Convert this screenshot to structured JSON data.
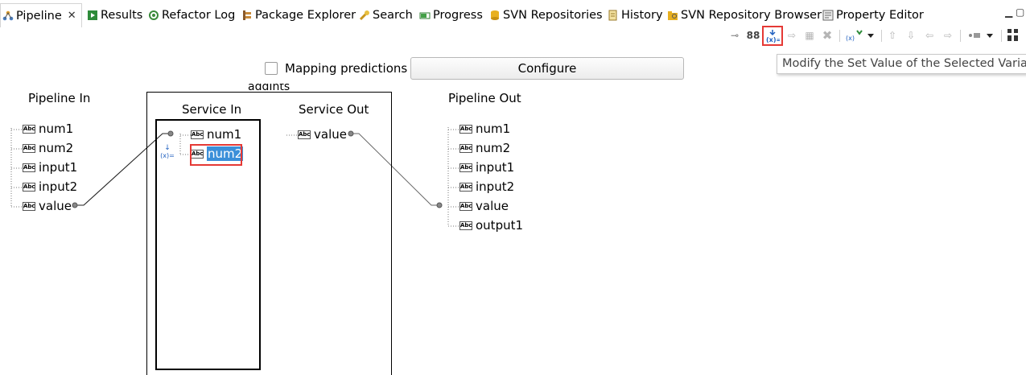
{
  "tabs": [
    {
      "label": "Pipeline",
      "icon": "pipeline-icon",
      "active": true,
      "close": "✕"
    },
    {
      "label": "Results",
      "icon": "results-icon"
    },
    {
      "label": "Refactor Log",
      "icon": "refactor-log-icon"
    },
    {
      "label": "Package Explorer",
      "icon": "package-explorer-icon"
    },
    {
      "label": "Search",
      "icon": "search-icon"
    },
    {
      "label": "Progress",
      "icon": "progress-icon"
    },
    {
      "label": "SVN Repositories",
      "icon": "svn-repositories-icon"
    },
    {
      "label": "History",
      "icon": "history-icon"
    },
    {
      "label": "SVN Repository Browser",
      "icon": "svn-browser-icon"
    },
    {
      "label": "Property Editor",
      "icon": "property-editor-icon"
    }
  ],
  "toolbar": {
    "buttons": [
      "link-icon",
      "link-group-icon",
      "set-value-icon",
      "copy-icon",
      "paste-icon",
      "delete-icon",
      "variable-dropdown-icon",
      "move-up-icon",
      "move-down-icon",
      "move-left-icon",
      "move-right-icon",
      "more-dropdown-icon",
      "layout-icon"
    ],
    "selected": "set-value-icon",
    "tooltip": "Modify the Set Value of the Selected Variable"
  },
  "mapping": {
    "predictions_label": "Mapping predictions",
    "predictions_checked": false,
    "configure_label": "Configure"
  },
  "service_name": "addInts",
  "pipeline_in": {
    "title": "Pipeline In",
    "items": [
      "num1",
      "num2",
      "input1",
      "input2",
      "value"
    ]
  },
  "service_in": {
    "title": "Service In",
    "items": [
      "num1",
      "num2"
    ],
    "selected": "num2",
    "set_value_marker": "(x)="
  },
  "service_out": {
    "title": "Service Out",
    "items": [
      "value"
    ]
  },
  "pipeline_out": {
    "title": "Pipeline Out",
    "items": [
      "num1",
      "num2",
      "input1",
      "input2",
      "value",
      "output1"
    ]
  },
  "type_badge": "Abc",
  "colors": {
    "highlight": "#3b8fd9",
    "annotation": "#e53935"
  }
}
